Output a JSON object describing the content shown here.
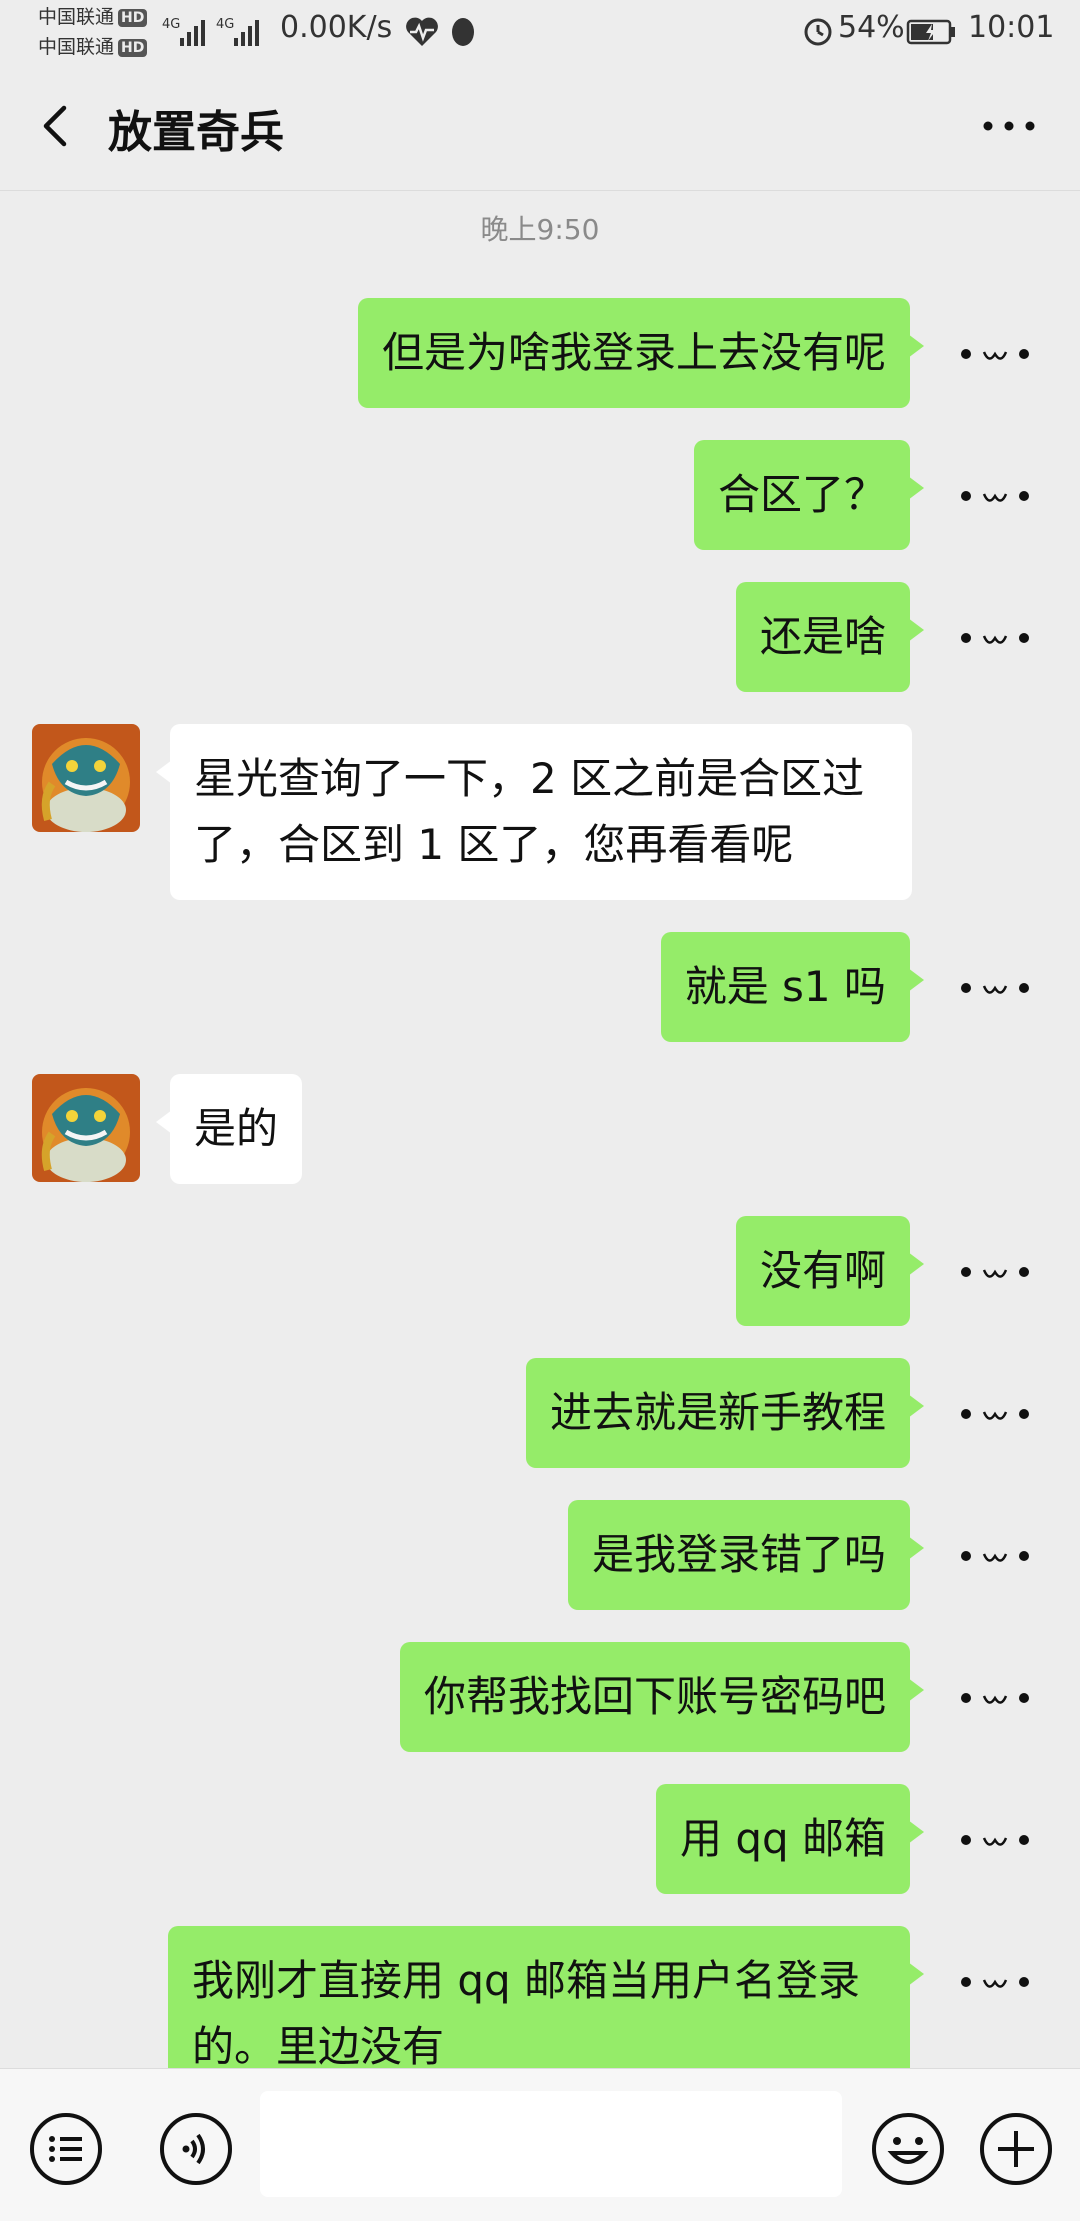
{
  "status_bar": {
    "carrier1": "中国联通",
    "carrier2": "中国联通",
    "hd_label": "HD",
    "net_label": "4G",
    "net_speed": "0.00K/s",
    "battery_pct": "54%",
    "time": "10:01",
    "icons": [
      "heart-rate-icon",
      "qq-penguin-icon",
      "alarm-icon",
      "battery-charging-icon"
    ]
  },
  "header": {
    "title": "放置奇兵",
    "back_icon": "chevron-left-icon",
    "more_icon": "more-horizontal-icon"
  },
  "chat": {
    "timestamp": "晚上9:50",
    "messages": [
      {
        "from": "me",
        "text": "但是为啥我登录上去没有呢"
      },
      {
        "from": "me",
        "text": "合区了？"
      },
      {
        "from": "me",
        "text": "还是啥"
      },
      {
        "from": "them",
        "text": "星光查询了一下，2 区之前是合区过了，合区到 1 区了，您再看看呢"
      },
      {
        "from": "me",
        "text": "就是 s1 吗"
      },
      {
        "from": "them",
        "text": "是的"
      },
      {
        "from": "me",
        "text": "没有啊"
      },
      {
        "from": "me",
        "text": "进去就是新手教程"
      },
      {
        "from": "me",
        "text": "是我登录错了吗"
      },
      {
        "from": "me",
        "text": "你帮我找回下账号密码吧"
      },
      {
        "from": "me",
        "text": "用 qq 邮箱"
      },
      {
        "from": "me",
        "text": "我刚才直接用 qq 邮箱当用户名登录的。里边没有"
      }
    ],
    "sticker_icon": "kaomoji-sticker-icon",
    "avatar_icon": "game-dragon-avatar"
  },
  "input_bar": {
    "placeholder": "",
    "icons": [
      "list-menu-icon",
      "voice-icon",
      "emoji-icon",
      "plus-icon"
    ]
  },
  "colors": {
    "background": "#ededed",
    "my_bubble": "#95ec69",
    "their_bubble": "#ffffff",
    "input_bar": "#f7f7f7"
  }
}
